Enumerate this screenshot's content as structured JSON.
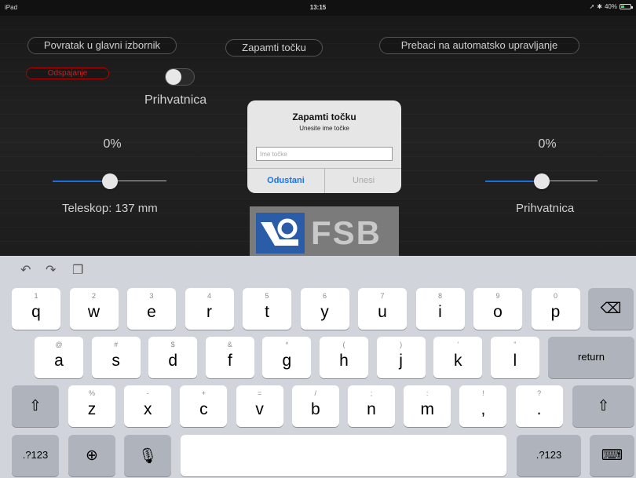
{
  "status_bar": {
    "device": "iPad",
    "time": "13:15",
    "battery": "40%",
    "location_icon": "location-arrow-icon",
    "bluetooth_icon": "bluetooth-icon"
  },
  "app": {
    "back_button": "Povratak u glavni izbornik",
    "save_point_button": "Zapamti točku",
    "auto_control_button": "Prebaci na automatsko upravljanje",
    "disconnect_button": "Odspajanje",
    "gripper_toggle_label": "Prihvatnica",
    "left_percent": "0%",
    "right_percent": "0%",
    "telescope_label": "Teleskop: 137 mm",
    "gripper_slider_label": "Prihvatnica",
    "telescope_slider_value": 0.5,
    "gripper_slider_value": 0.5,
    "logo_text": "FSB",
    "accent_color": "#1a6fe0",
    "disconnect_color": "#d51a1a"
  },
  "dialog": {
    "title": "Zapamti točku",
    "message": "Unesite ime točke",
    "input_placeholder": "Ime točke",
    "cancel_button": "Odustani",
    "confirm_button": "Unesi"
  },
  "keyboard": {
    "row1": [
      {
        "alt": "1",
        "key": "q"
      },
      {
        "alt": "2",
        "key": "w"
      },
      {
        "alt": "3",
        "key": "e"
      },
      {
        "alt": "4",
        "key": "r"
      },
      {
        "alt": "5",
        "key": "t"
      },
      {
        "alt": "6",
        "key": "y"
      },
      {
        "alt": "7",
        "key": "u"
      },
      {
        "alt": "8",
        "key": "i"
      },
      {
        "alt": "9",
        "key": "o"
      },
      {
        "alt": "0",
        "key": "p"
      }
    ],
    "row2": [
      {
        "alt": "@",
        "key": "a"
      },
      {
        "alt": "#",
        "key": "s"
      },
      {
        "alt": "$",
        "key": "d"
      },
      {
        "alt": "&",
        "key": "f"
      },
      {
        "alt": "*",
        "key": "g"
      },
      {
        "alt": "(",
        "key": "h"
      },
      {
        "alt": ")",
        "key": "j"
      },
      {
        "alt": "’",
        "key": "k"
      },
      {
        "alt": "”",
        "key": "l"
      }
    ],
    "row3": [
      {
        "alt": "%",
        "key": "z"
      },
      {
        "alt": "-",
        "key": "x"
      },
      {
        "alt": "+",
        "key": "c"
      },
      {
        "alt": "=",
        "key": "v"
      },
      {
        "alt": "/",
        "key": "b"
      },
      {
        "alt": ";",
        "key": "n"
      },
      {
        "alt": ":",
        "key": "m"
      },
      {
        "alt": "!",
        "key": ","
      },
      {
        "alt": "?",
        "key": "."
      }
    ],
    "return_key": "return",
    "numbers_key": ".?123",
    "numbers_key_right": ".?123"
  }
}
